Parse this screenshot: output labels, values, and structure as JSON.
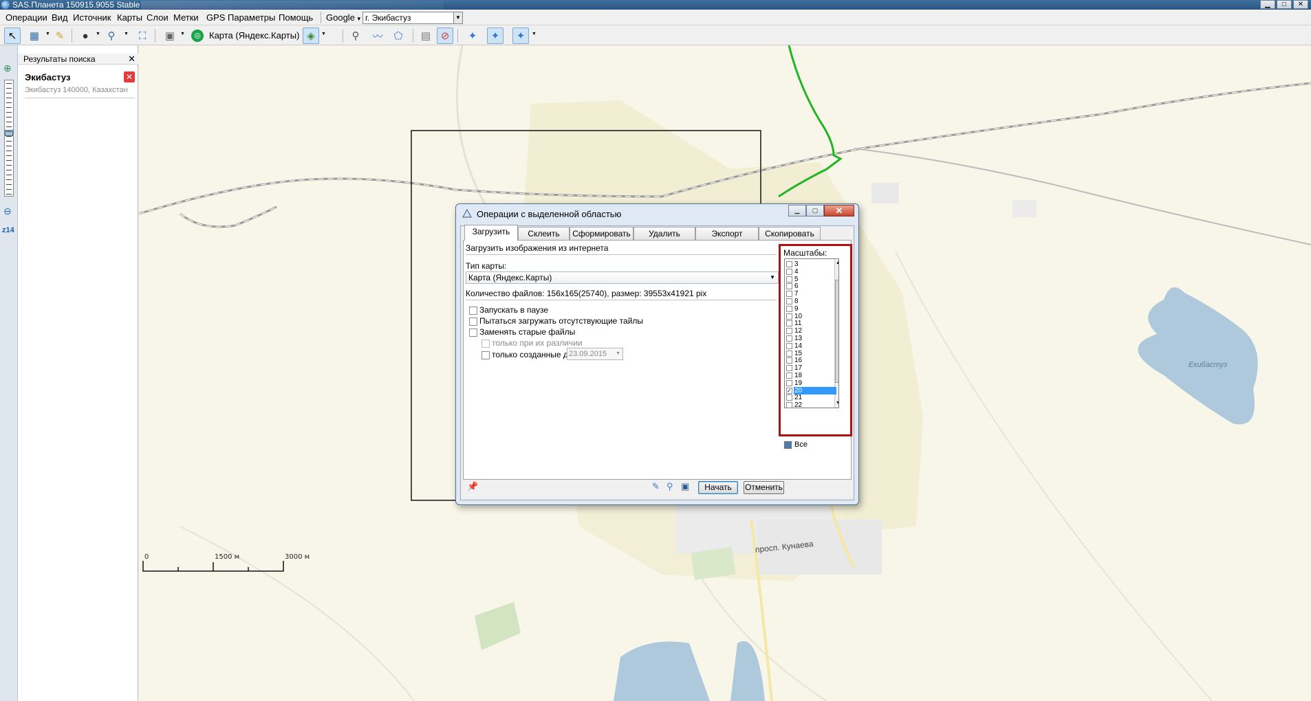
{
  "window": {
    "title": "SAS.Планета 150915.9055 Stable",
    "controls": {
      "minimize": "▁",
      "maximize": "□",
      "close": "✕"
    }
  },
  "menu": {
    "items": [
      "Операции",
      "Вид",
      "Источник",
      "Карты",
      "Слои",
      "Метки",
      "GPS",
      "Параметры",
      "Помощь"
    ],
    "provider": "Google",
    "search_value": "г. Экибастуз"
  },
  "toolbar": {
    "map_type": "Карта (Яндекс.Карты)",
    "icons": [
      "pointer-icon",
      "select-area-icon",
      "ruler-icon",
      "globe-icon",
      "zoom-icon",
      "fullscreen-icon",
      "satellite-icon",
      "map-source-icon",
      "layers-icon",
      "placemark-icon",
      "path-icon",
      "polygon-icon",
      "placemark-list-icon",
      "hide-marks-icon",
      "gps-icon",
      "gps-track-icon",
      "gps-center-icon"
    ]
  },
  "zoom": {
    "level": "z14",
    "slider_fraction": 0.45
  },
  "search_panel": {
    "header": "Результаты поиска",
    "close": "✕",
    "result_title": "Экибастуз",
    "result_remove": "✕",
    "result_address": "Экибастуз 140000, Казахстан"
  },
  "map": {
    "lake_label": "Екибастуз",
    "street_label": "просп. Кунаева",
    "scale_labels": [
      "0",
      "1500 м",
      "3000 м"
    ]
  },
  "dialog": {
    "title": "Операции с выделенной областью",
    "tabs": [
      "Загрузить",
      "Склеить",
      "Сформировать",
      "Удалить",
      "Экспорт",
      "Скопировать"
    ],
    "active_tab": "Загрузить",
    "heading": "Загрузить изображения из интернета",
    "map_type_label": "Тип карты:",
    "map_type_value": "Карта (Яндекс.Карты)",
    "files_info": "Количество файлов: 156x165(25740), размер: 39553x41921 pix",
    "checkboxes": [
      {
        "label": "Запускать в паузе",
        "checked": false
      },
      {
        "label": "Пытаться загружать отсутствующие тайлы",
        "checked": false
      },
      {
        "label": "Заменять старые файлы",
        "checked": false
      }
    ],
    "sub_checkboxes": [
      {
        "label": "только при их различии",
        "checked": false,
        "enabled": false
      },
      {
        "label": "только созданные до",
        "checked": false,
        "enabled": true
      }
    ],
    "date_value": "23.09.2015",
    "scales_label": "Масштабы:",
    "scales": [
      "3",
      "4",
      "5",
      "6",
      "7",
      "8",
      "9",
      "10",
      "11",
      "12",
      "13",
      "14",
      "15",
      "16",
      "17",
      "18",
      "19",
      "20",
      "21",
      "22"
    ],
    "selected_scale": "20",
    "all_label": "Все",
    "start_button": "Начать",
    "cancel_button": "Отменить"
  }
}
